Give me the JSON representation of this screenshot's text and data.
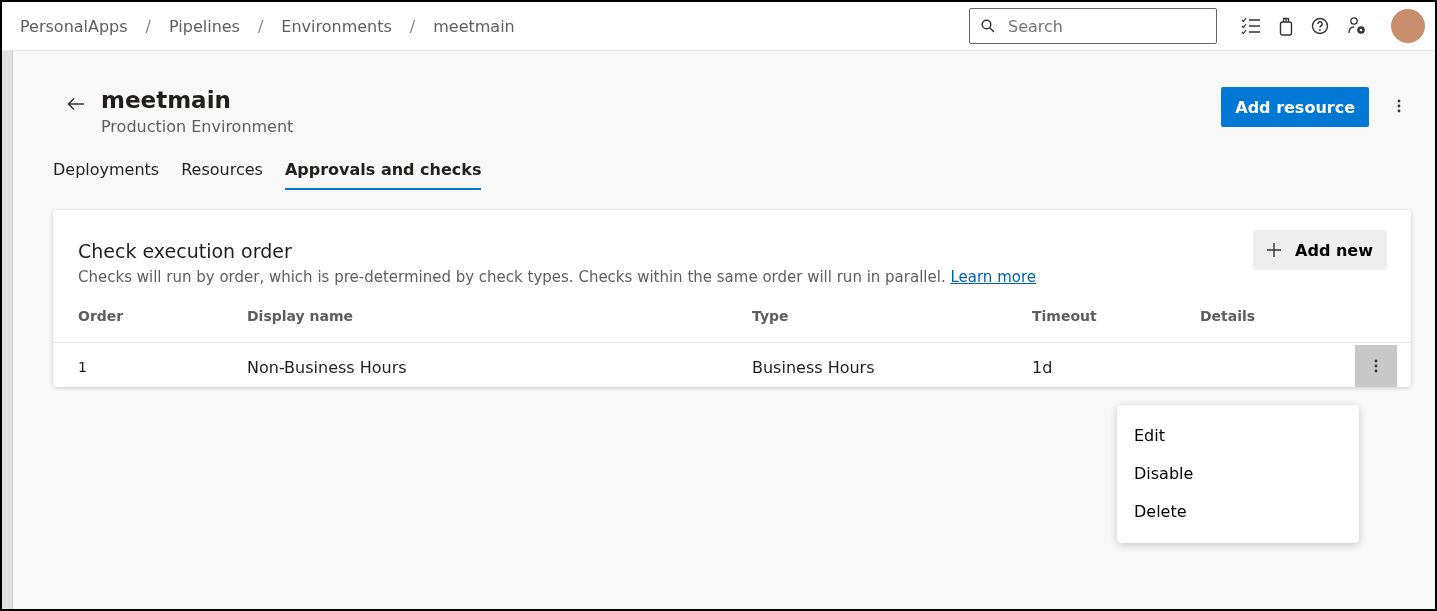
{
  "breadcrumb": [
    {
      "kind": "link",
      "text": "PersonalApps"
    },
    {
      "kind": "separator",
      "text": "/"
    },
    {
      "kind": "link",
      "text": "Pipelines"
    },
    {
      "kind": "separator",
      "text": "/"
    },
    {
      "kind": "link",
      "text": "Environments"
    },
    {
      "kind": "separator",
      "text": "/"
    },
    {
      "kind": "link",
      "text": "meetmain"
    }
  ],
  "search": {
    "placeholder": "Search"
  },
  "header": {
    "title": "meetmain",
    "subtitle": "Production Environment",
    "primary_button": "Add resource"
  },
  "tabs": [
    {
      "label": "Deployments",
      "selected": false
    },
    {
      "label": "Resources",
      "selected": false
    },
    {
      "label": "Approvals and checks",
      "selected": true
    }
  ],
  "card": {
    "title": "Check execution order",
    "description": "Checks will run by order, which is pre-determined by check types. Checks within the same order will run in parallel.",
    "link": "Learn more",
    "add_button": "Add new",
    "columns": [
      "Order",
      "Display name",
      "Type",
      "Timeout",
      "Details"
    ],
    "rows": [
      {
        "order": "1",
        "display_name": "Non-Business Hours",
        "type": "Business Hours",
        "timeout": "1d",
        "menu_open": true
      }
    ]
  },
  "context_menu": [
    "Edit",
    "Disable",
    "Delete"
  ]
}
